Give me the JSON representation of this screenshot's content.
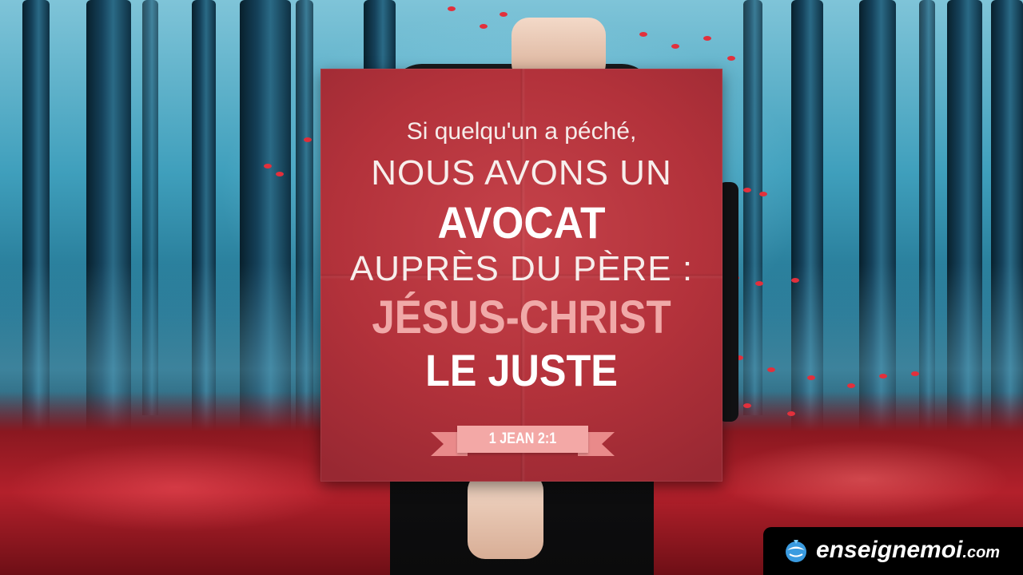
{
  "sign": {
    "line1": "Si quelqu'un a péché,",
    "line2": "NOUS AVONS UN",
    "line3": "AVOCAT",
    "line4": "AUPRÈS DU PÈRE :",
    "line5": "JÉSUS-CHRIST",
    "line6": "LE JUSTE",
    "reference": "1 JEAN 2:1"
  },
  "watermark": {
    "name": "enseignemoi",
    "suffix": ".com",
    "icon": "globe-logo-icon"
  },
  "colors": {
    "sign": "#b3323b",
    "highlight": "#f0a9a8",
    "ribbon": "#f3a8a6"
  }
}
